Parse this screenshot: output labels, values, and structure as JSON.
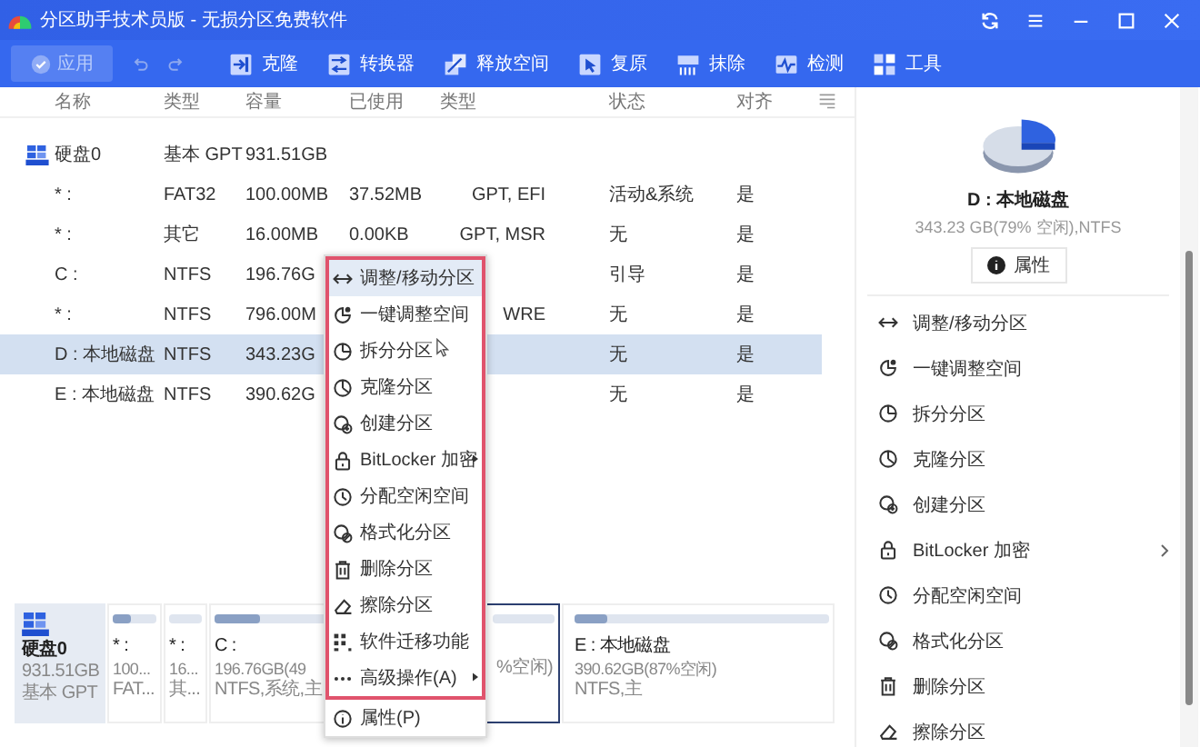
{
  "window": {
    "title": "分区助手技术员版 - 无损分区免费软件"
  },
  "toolbar": {
    "apply": {
      "label": "应用",
      "disabled": true
    },
    "tools": [
      {
        "label": "克隆"
      },
      {
        "label": "转换器"
      },
      {
        "label": "释放空间"
      },
      {
        "label": "复原"
      },
      {
        "label": "抹除"
      },
      {
        "label": "检测"
      },
      {
        "label": "工具"
      }
    ]
  },
  "table": {
    "columns": [
      "名称",
      "类型",
      "容量",
      "已使用",
      "类型",
      "状态",
      "对齐"
    ],
    "rows": [
      {
        "kind": "disk",
        "name": "硬盘0",
        "fs": "基本 GPT",
        "capacity": "931.51GB",
        "selected": false
      },
      {
        "kind": "partition",
        "name": "* :",
        "fs": "FAT32",
        "capacity": "100.00MB",
        "used": "37.52MB",
        "type": "GPT, EFI",
        "status": "活动&系统",
        "align": "是",
        "selected": false
      },
      {
        "kind": "partition",
        "name": "* :",
        "fs": "其它",
        "capacity": "16.00MB",
        "used": "0.00KB",
        "type": "GPT, MSR",
        "status": "无",
        "align": "是",
        "selected": false
      },
      {
        "kind": "partition",
        "name": "C :",
        "fs": "NTFS",
        "capacity": "196.76G",
        "status": "引导",
        "align": "是",
        "selected": false
      },
      {
        "kind": "partition",
        "name": "* :",
        "fs": "NTFS",
        "capacity": "796.00M",
        "type": "WRE",
        "status": "无",
        "align": "是",
        "selected": false
      },
      {
        "kind": "partition",
        "name": "D : 本地磁盘",
        "fs": "NTFS",
        "capacity": "343.23G",
        "status": "无",
        "align": "是",
        "selected": true
      },
      {
        "kind": "partition",
        "name": "E : 本地磁盘",
        "fs": "NTFS",
        "capacity": "390.62G",
        "status": "无",
        "align": "是",
        "selected": false
      }
    ]
  },
  "context_menu": {
    "items": [
      {
        "label": "调整/移动分区",
        "selected": true
      },
      {
        "label": "一键调整空间",
        "selected": false
      },
      {
        "label": "拆分分区",
        "selected": false
      },
      {
        "label": "克隆分区",
        "selected": false
      },
      {
        "label": "创建分区",
        "selected": false
      },
      {
        "label": "BitLocker 加密",
        "selected": false,
        "submenu": true
      },
      {
        "label": "分配空闲空间",
        "selected": false
      },
      {
        "label": "格式化分区",
        "selected": false
      },
      {
        "label": "删除分区",
        "selected": false
      },
      {
        "label": "擦除分区",
        "selected": false
      },
      {
        "label": "软件迁移功能",
        "selected": false
      },
      {
        "label": "高级操作(A)",
        "selected": false,
        "submenu": true
      },
      {
        "label": "属性(P)",
        "selected": false
      }
    ]
  },
  "disk_map": {
    "disk": {
      "name": "硬盘0",
      "size": "931.51GB",
      "type": "基本 GPT"
    },
    "partitions": [
      {
        "name": "* :",
        "size": "100...",
        "info": "FAT...",
        "level": 0.4,
        "selected": false
      },
      {
        "name": "* :",
        "size": "16...",
        "info": "其...",
        "selected": false
      },
      {
        "name": "C :",
        "size": "196.76GB(49",
        "info": "NTFS,系统,主",
        "level": 0.22,
        "selected": false
      },
      {
        "size": "%空闲)",
        "selected": true
      },
      {
        "name": "E : 本地磁盘",
        "size": "390.62GB(87%空闲)",
        "info": "NTFS,主",
        "level": 0.13,
        "selected": false
      }
    ]
  },
  "details": {
    "name": "D : 本地磁盘",
    "info": "343.23 GB(79% 空闲),NTFS",
    "button": "属性",
    "actions": [
      {
        "label": "调整/移动分区"
      },
      {
        "label": "一键调整空间"
      },
      {
        "label": "拆分分区"
      },
      {
        "label": "克隆分区"
      },
      {
        "label": "创建分区"
      },
      {
        "label": "BitLocker 加密",
        "submenu": true
      },
      {
        "label": "分配空闲空间"
      },
      {
        "label": "格式化分区"
      },
      {
        "label": "删除分区"
      },
      {
        "label": "擦除分区"
      }
    ]
  }
}
